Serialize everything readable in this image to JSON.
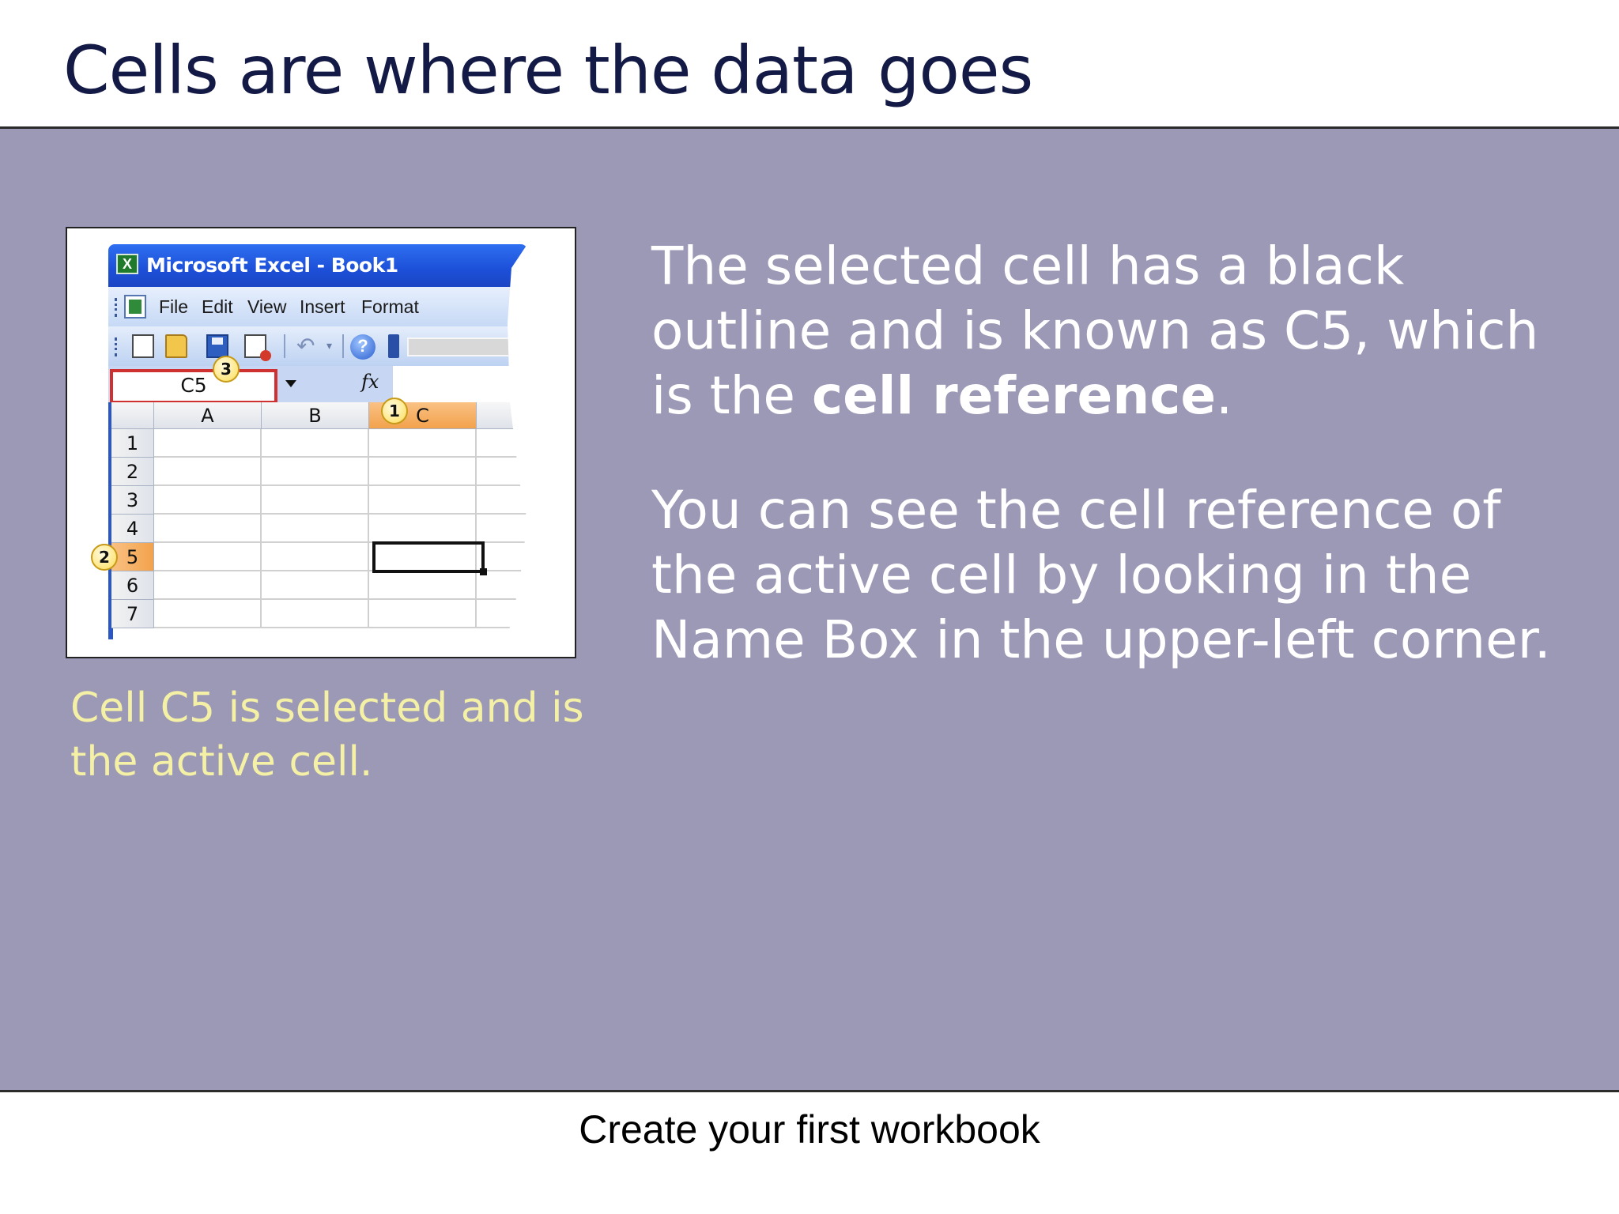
{
  "slide": {
    "title": "Cells are where the data goes",
    "footer": "Create your first workbook",
    "caption": "Cell C5 is selected and is the active cell.",
    "paragraph1": {
      "text_before": "The selected cell has a black outline and is known as C5, which is the ",
      "bold": "cell reference",
      "text_after": "."
    },
    "paragraph2": "You can see the cell reference of the active cell by looking in the Name Box in the upper-left corner."
  },
  "excel": {
    "window_title": "Microsoft Excel - Book1",
    "logo_glyph": "X",
    "menu": [
      "File",
      "Edit",
      "View",
      "Insert",
      "Format"
    ],
    "help_glyph": "?",
    "undo_glyph": "↶",
    "dropdown_glyph": "▾",
    "name_box_value": "C5",
    "fx_label": "fx",
    "columns": [
      "A",
      "B",
      "C"
    ],
    "rows": [
      "1",
      "2",
      "3",
      "4",
      "5",
      "6",
      "7"
    ],
    "selected_column": "C",
    "selected_row": "5",
    "callouts": [
      "1",
      "2",
      "3"
    ]
  },
  "colors": {
    "title": "#141a46",
    "panel": "#9c99b6",
    "caption": "#f4f0a6",
    "body_text": "#ffffff",
    "name_box_border": "#cf3030",
    "selected_header": "#f2a24c"
  }
}
